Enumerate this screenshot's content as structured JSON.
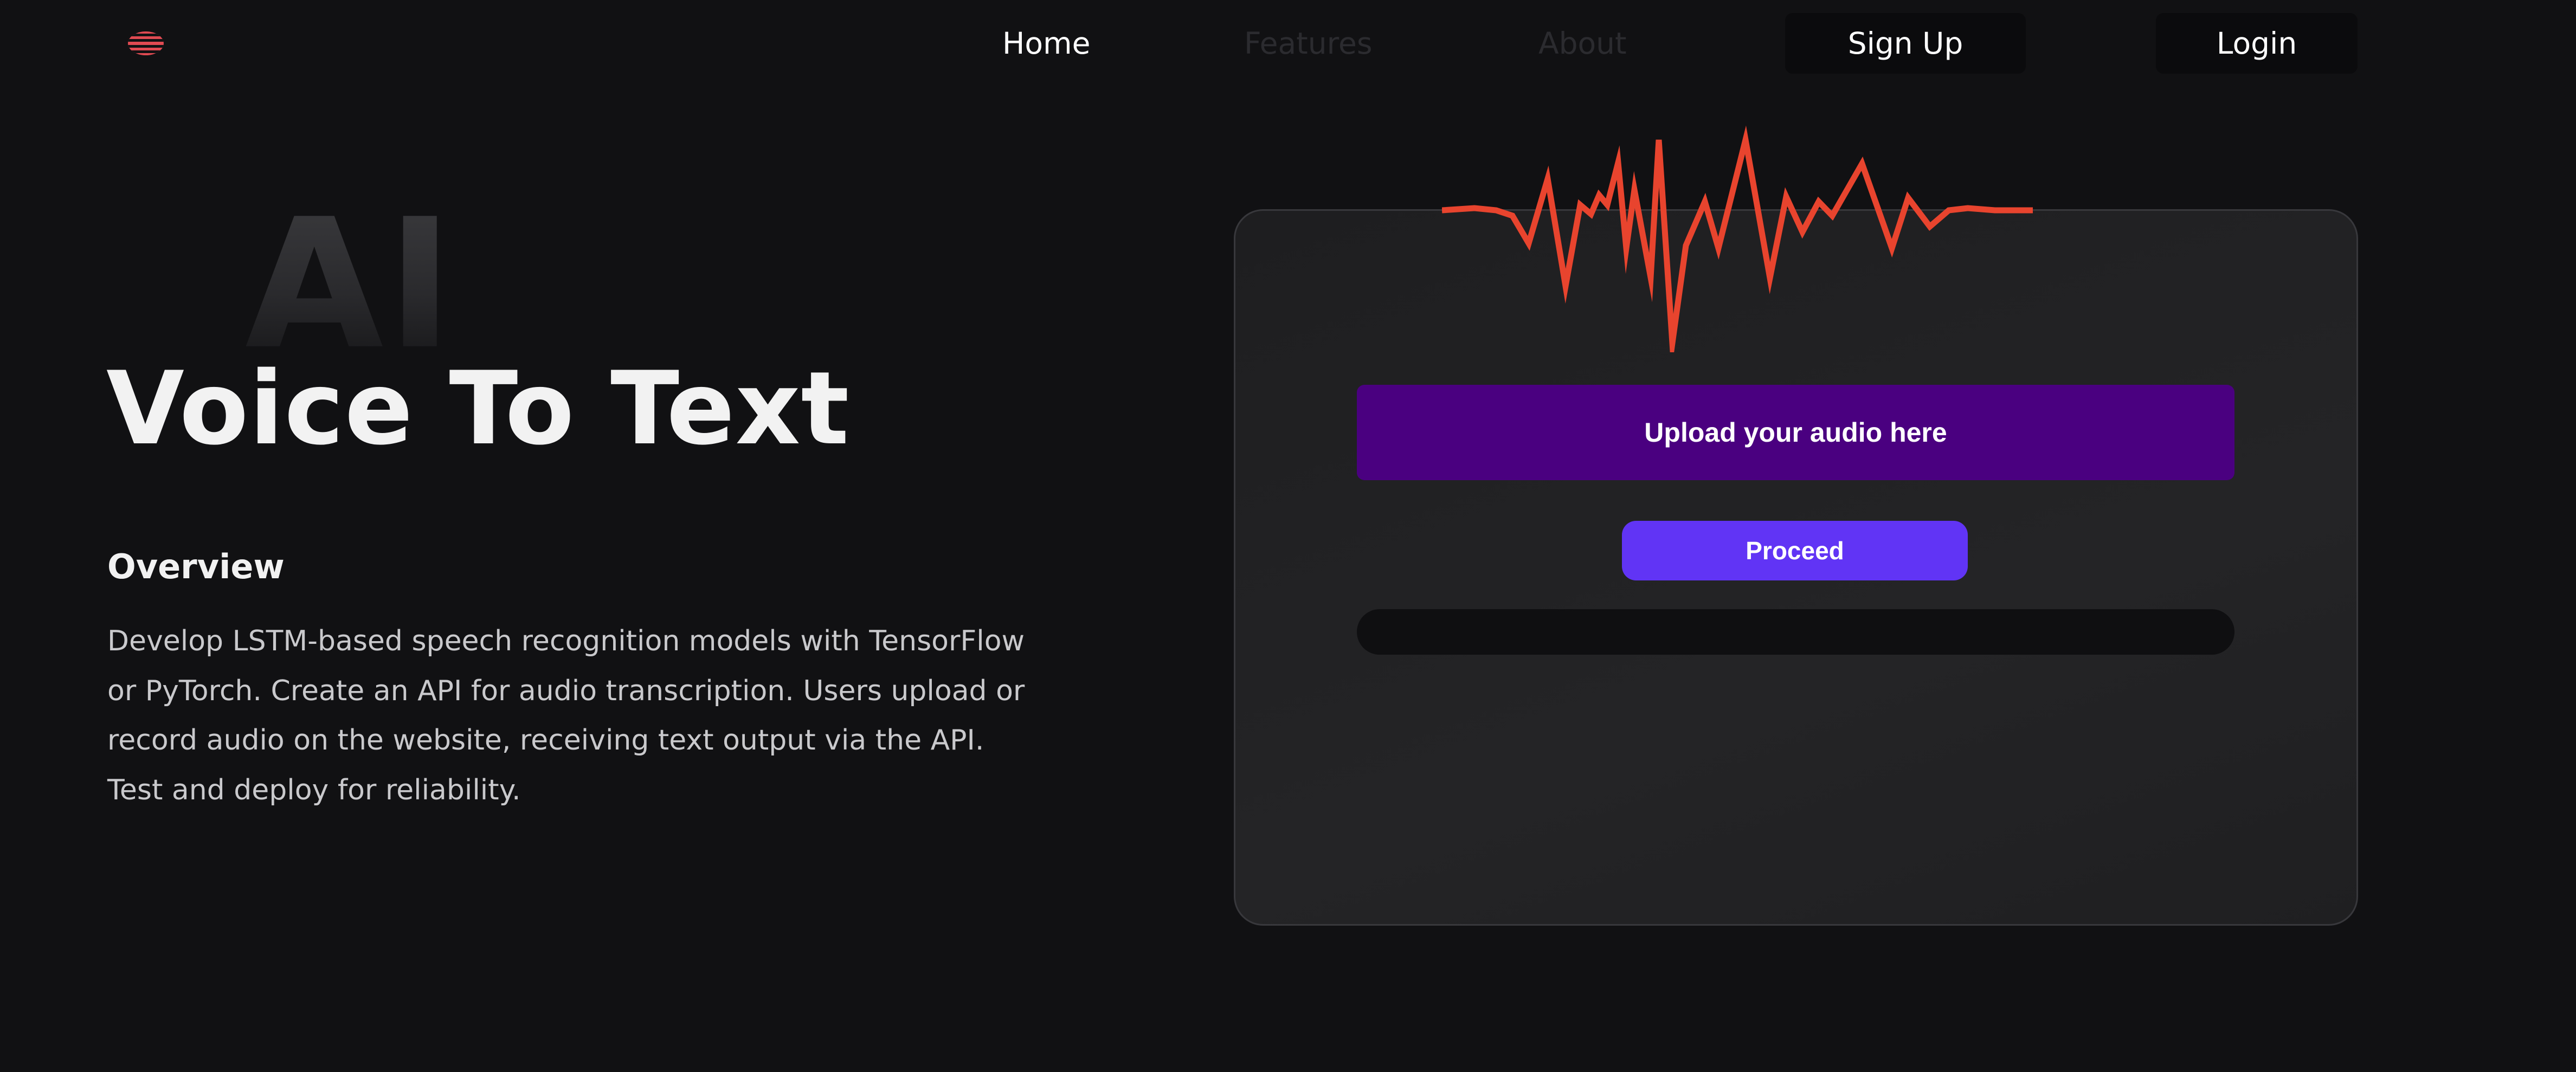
{
  "nav": {
    "logo_icon": "striped-globe-logo-icon",
    "links": {
      "home": "Home",
      "features": "Features",
      "about": "About"
    },
    "buttons": {
      "signup": "Sign Up",
      "login": "Login"
    }
  },
  "hero": {
    "backdrop_text": "AI",
    "title": "Voice To Text"
  },
  "overview": {
    "heading": "Overview",
    "body": "Develop LSTM-based speech recognition models with TensorFlow or PyTorch. Create an API for audio transcription. Users upload or record audio on the website, receiving text output via the API. Test and deploy for reliability."
  },
  "converter": {
    "wave_icon": "sound-wave-icon",
    "upload_label": "Upload your audio here",
    "proceed_label": "Proceed",
    "output_value": ""
  },
  "colors": {
    "background": "#111113",
    "card": "#222224",
    "wave": "#e8442e",
    "upload_button": "#4a0080",
    "proceed_button": "#6134f5"
  }
}
